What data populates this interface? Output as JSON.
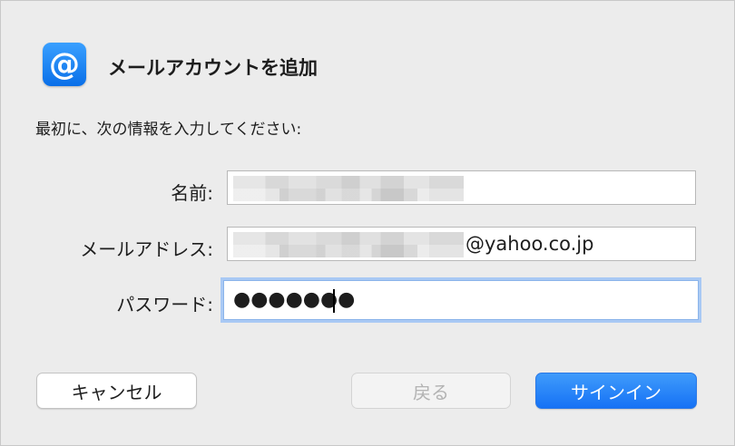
{
  "dialog": {
    "icon": "@",
    "title": "メールアカウントを追加",
    "instruction": "最初に、次の情報を入力してください:"
  },
  "form": {
    "name_label": "名前:",
    "email_label": "メールアドレス:",
    "email_domain": "@yahoo.co.jp",
    "password_label": "パスワード:",
    "password_masked": "●●●●●●●"
  },
  "buttons": {
    "cancel": "キャンセル",
    "back": "戻る",
    "signin": "サインイン"
  },
  "colors": {
    "accent": "#1672f5",
    "focus_ring": "#a9c9f4"
  }
}
